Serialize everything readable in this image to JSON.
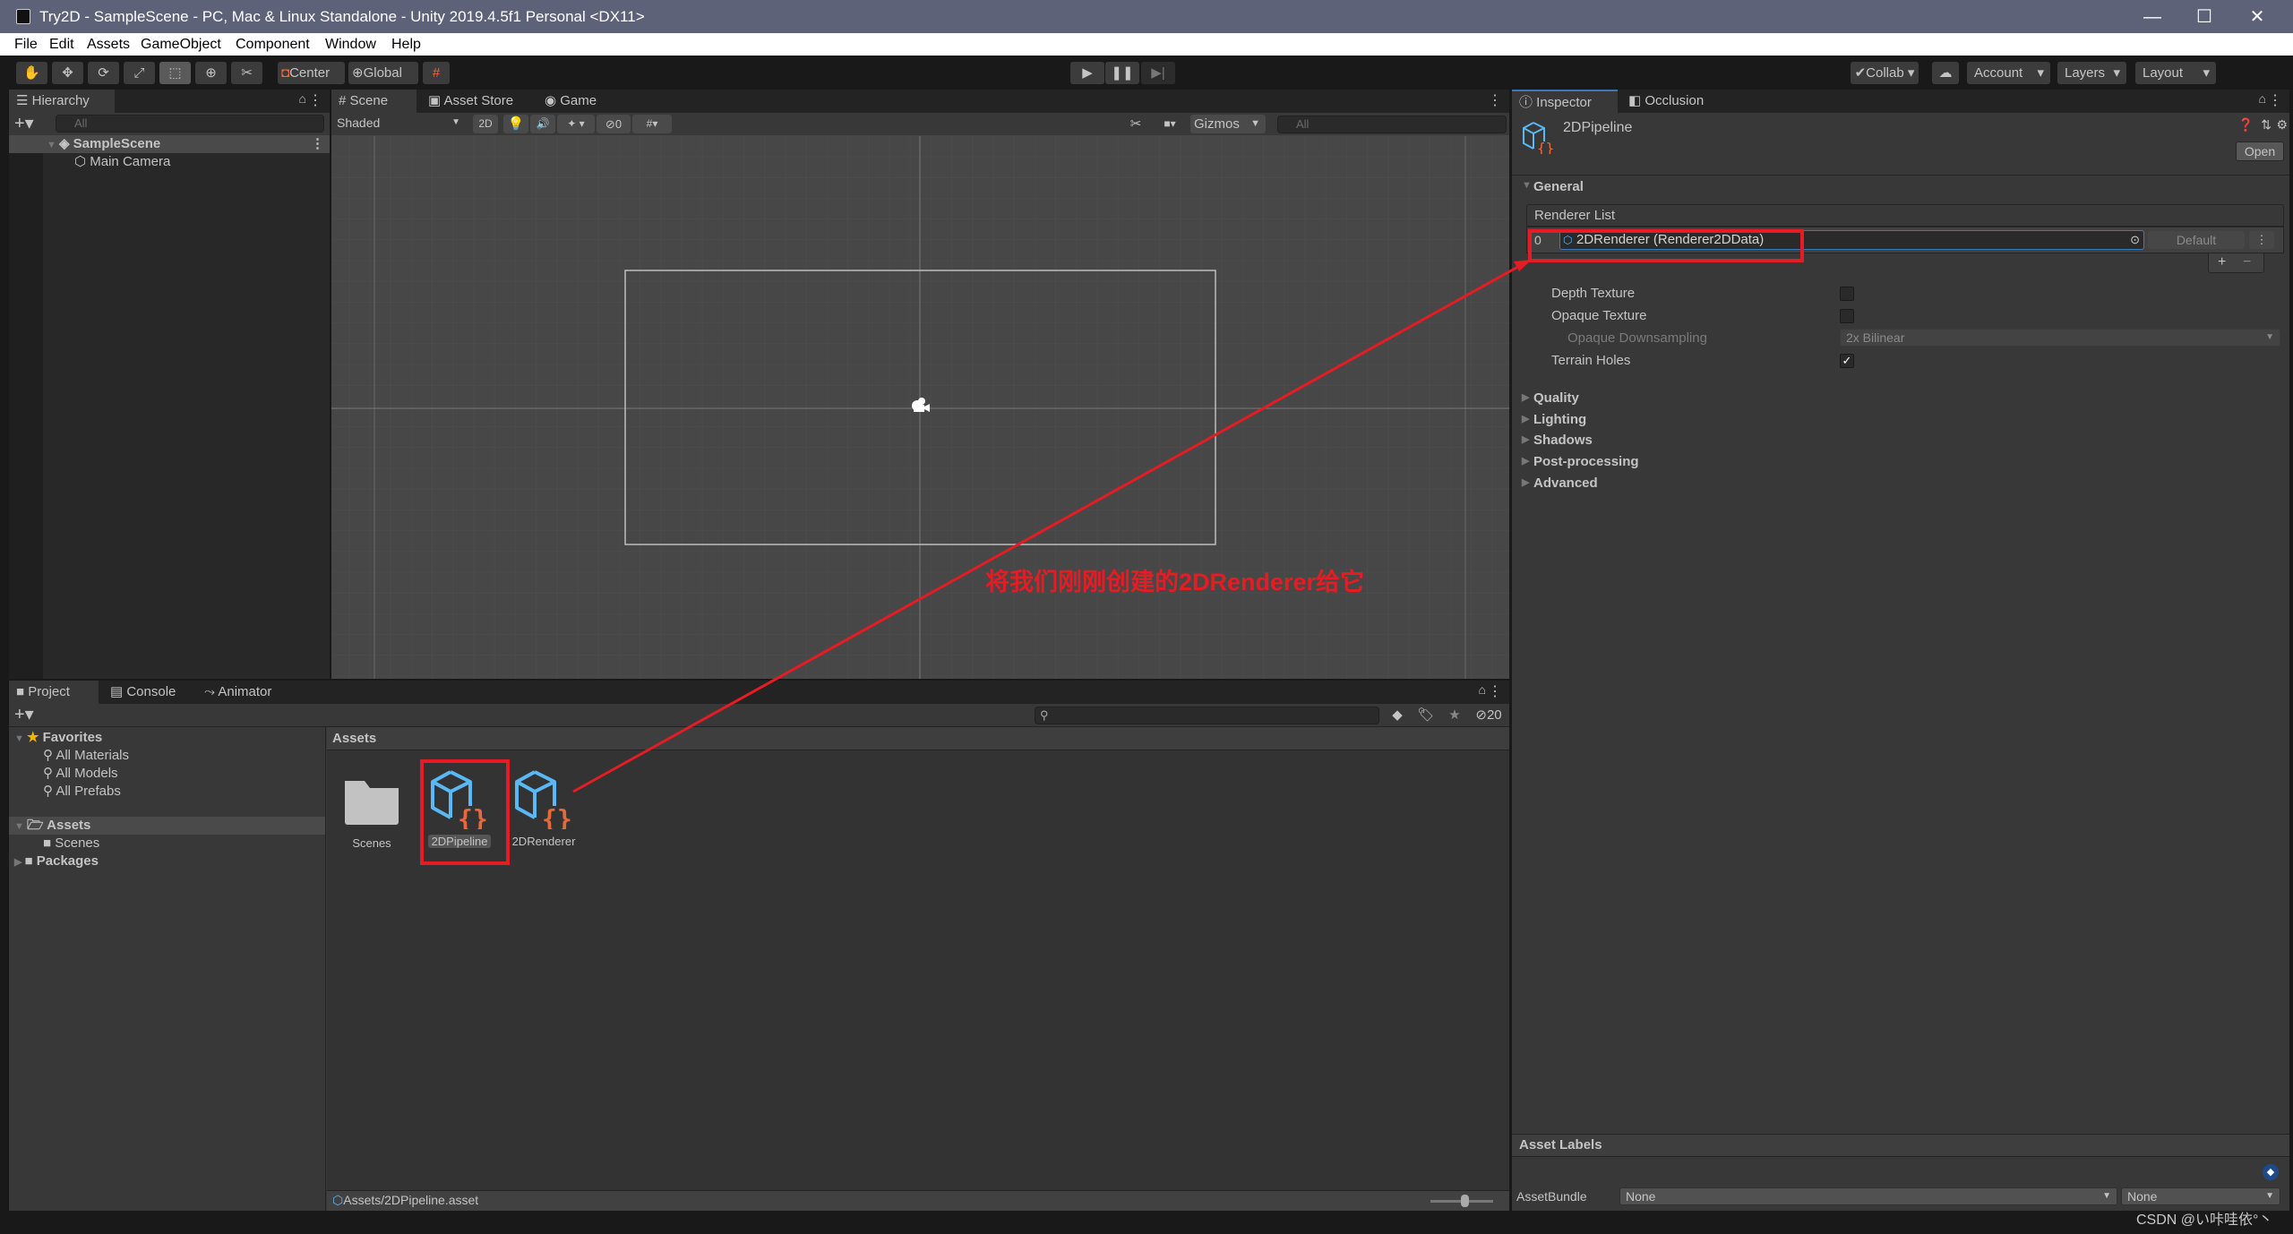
{
  "window": {
    "title": "Try2D - SampleScene - PC, Mac & Linux Standalone - Unity 2019.4.5f1 Personal <DX11>",
    "minimize": "—",
    "maximize": "☐",
    "close": "✕"
  },
  "menu": [
    "File",
    "Edit",
    "Assets",
    "GameObject",
    "Component",
    "Window",
    "Help"
  ],
  "toolbar": {
    "tools": [
      "hand-tool",
      "move-tool",
      "rotate-tool",
      "scale-tool",
      "rect-tool",
      "transform-tool",
      "custom-tool"
    ],
    "pivot": "Center",
    "space": "Global",
    "collab": "Collab",
    "account": "Account",
    "layers": "Layers",
    "layout": "Layout"
  },
  "hierarchy": {
    "tab": "Hierarchy",
    "search_placeholder": "All",
    "scene": "SampleScene",
    "items": [
      "Main Camera"
    ]
  },
  "scene_view": {
    "tabs": [
      "Scene",
      "Asset Store",
      "Game"
    ],
    "shading": "Shaded",
    "mode_2d": "2D",
    "hidden_count": "0",
    "gizmos": "Gizmos",
    "search_placeholder": "All",
    "annotation": "将我们刚刚创建的2DRenderer给它"
  },
  "inspector": {
    "tabs": [
      "Inspector",
      "Occlusion"
    ],
    "asset_name": "2DPipeline",
    "open_button": "Open",
    "general": "General",
    "renderer_list_label": "Renderer List",
    "renderer_index": "0",
    "renderer_value": "2DRenderer (Renderer2DData)",
    "default_button": "Default",
    "plus": "+",
    "minus": "−",
    "fields": {
      "depth_texture": {
        "label": "Depth Texture",
        "checked": false
      },
      "opaque_texture": {
        "label": "Opaque Texture",
        "checked": false
      },
      "opaque_downsampling": {
        "label": "Opaque Downsampling",
        "value": "2x Bilinear"
      },
      "terrain_holes": {
        "label": "Terrain Holes",
        "checked": true,
        "mark": "✓"
      }
    },
    "sections": [
      "Quality",
      "Lighting",
      "Shadows",
      "Post-processing",
      "Advanced"
    ],
    "asset_labels": "Asset Labels",
    "asset_bundle_label": "AssetBundle",
    "asset_bundle_value": "None",
    "asset_bundle_variant": "None"
  },
  "project": {
    "tabs": [
      "Project",
      "Console",
      "Animator"
    ],
    "hidden_count": "20",
    "favorites": "Favorites",
    "favorite_items": [
      "All Materials",
      "All Models",
      "All Prefabs"
    ],
    "assets_root": "Assets",
    "assets_children": [
      "Scenes"
    ],
    "packages": "Packages",
    "breadcrumb": "Assets",
    "grid_items": [
      "Scenes",
      "2DPipeline",
      "2DRenderer"
    ],
    "selected_path": "Assets/2DPipeline.asset"
  },
  "watermark": "CSDN @い咔哇依°丶",
  "colors": {
    "accent": "#3a79bb",
    "annotation": "#e51c23",
    "asset_blue": "#5ab8f5",
    "asset_orange": "#e6693e"
  }
}
